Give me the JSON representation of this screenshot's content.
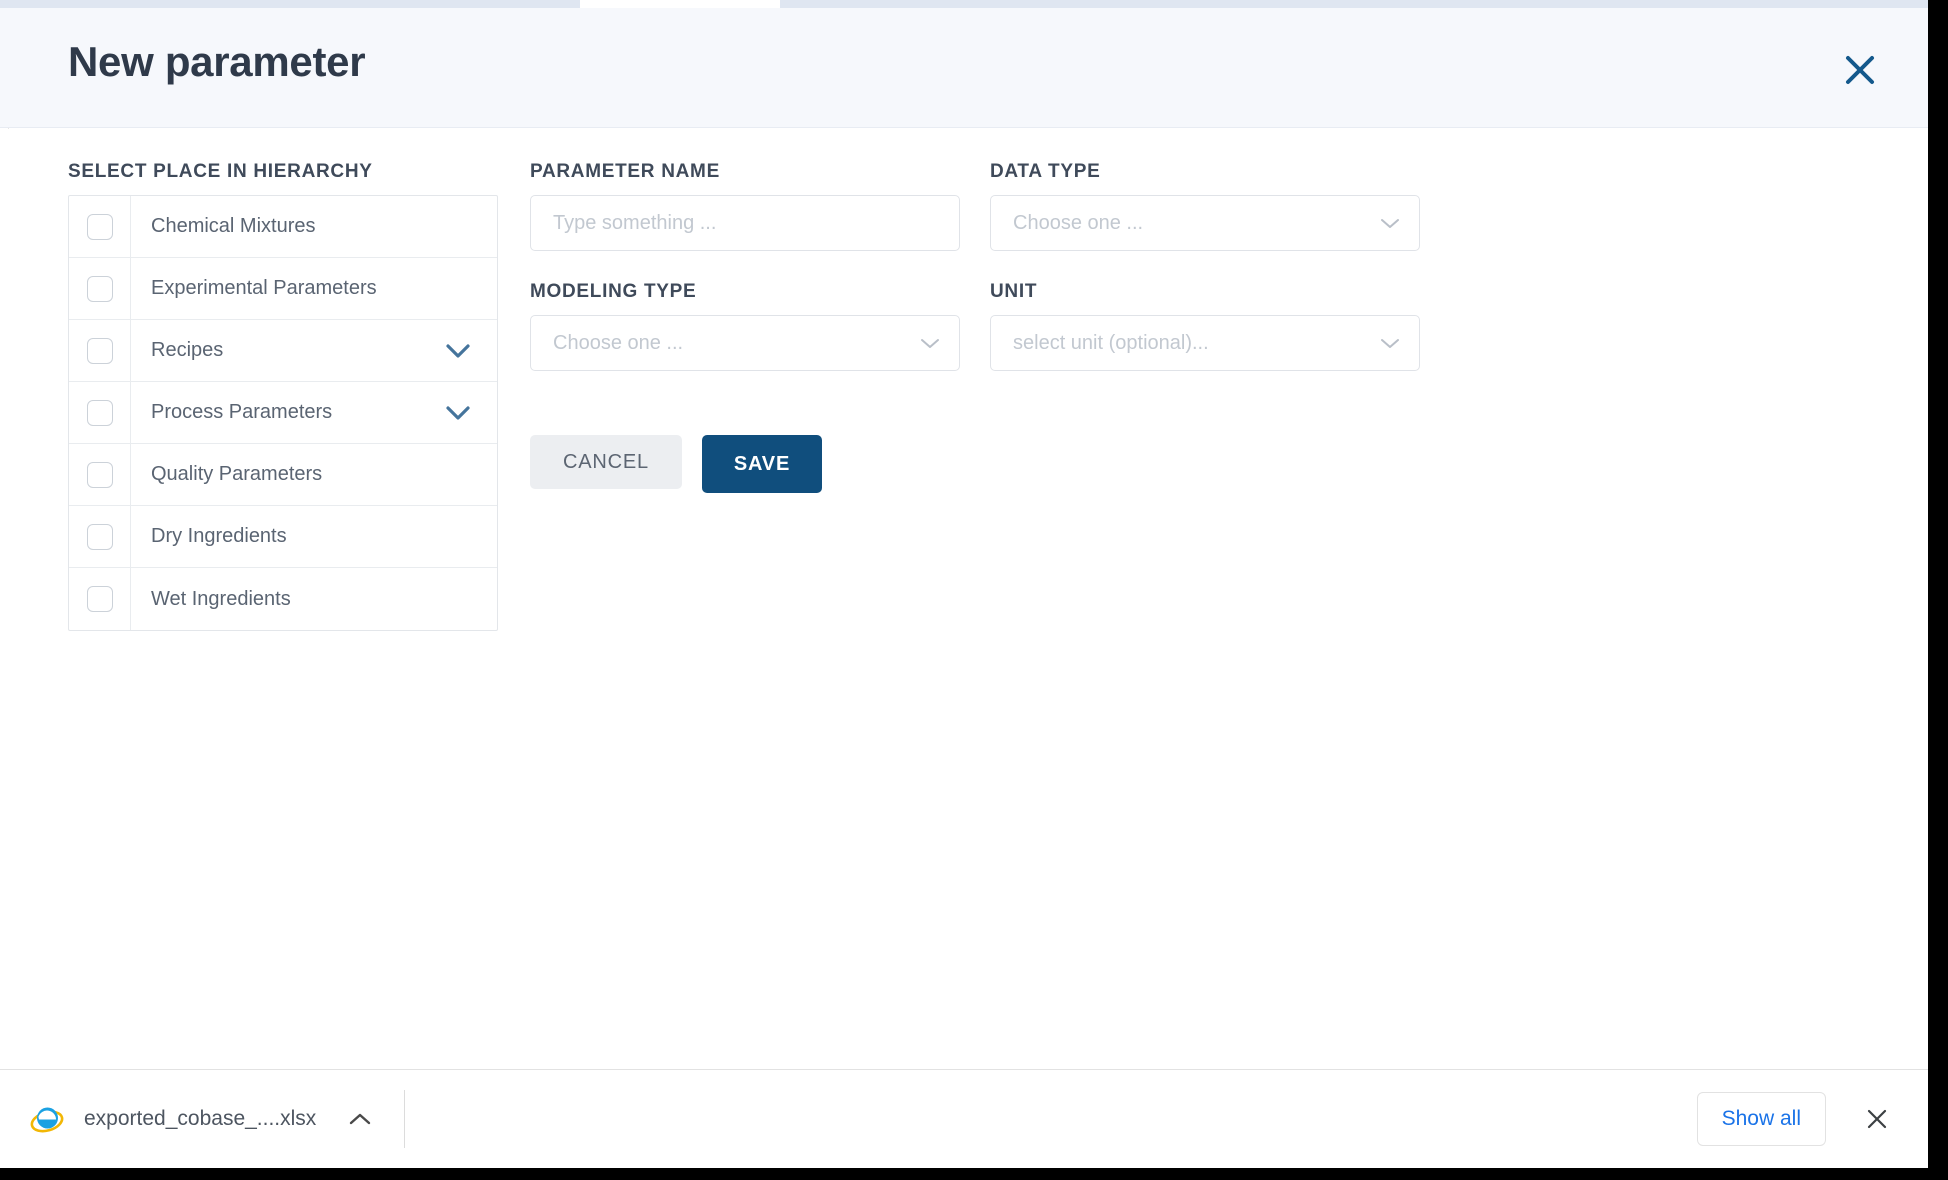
{
  "modal": {
    "title": "New parameter",
    "close_icon": "close-icon"
  },
  "hierarchy": {
    "label": "SELECT PLACE IN HIERARCHY",
    "items": [
      {
        "label": "Chemical Mixtures",
        "checked": false,
        "expandable": false
      },
      {
        "label": "Experimental Parameters",
        "checked": false,
        "expandable": false
      },
      {
        "label": "Recipes",
        "checked": false,
        "expandable": true
      },
      {
        "label": "Process Parameters",
        "checked": false,
        "expandable": true
      },
      {
        "label": "Quality Parameters",
        "checked": false,
        "expandable": false
      },
      {
        "label": "Dry Ingredients",
        "checked": false,
        "expandable": false
      },
      {
        "label": "Wet Ingredients",
        "checked": false,
        "expandable": false
      }
    ]
  },
  "form": {
    "parameter_name": {
      "label": "PARAMETER NAME",
      "value": "",
      "placeholder": "Type something ..."
    },
    "data_type": {
      "label": "DATA TYPE",
      "value": "Choose one ..."
    },
    "modeling_type": {
      "label": "MODELING TYPE",
      "value": "Choose one ..."
    },
    "unit": {
      "label": "UNIT",
      "value": "select unit (optional)..."
    }
  },
  "actions": {
    "cancel_label": "CANCEL",
    "save_label": "SAVE",
    "save_color": "#104e7d"
  },
  "download_bar": {
    "file_name": "exported_cobase_....xlsx",
    "file_icon": "internet-explorer-icon",
    "menu_icon": "chevron-up-icon",
    "show_all_label": "Show all",
    "close_icon": "close-icon",
    "link_color": "#1a73e8"
  }
}
